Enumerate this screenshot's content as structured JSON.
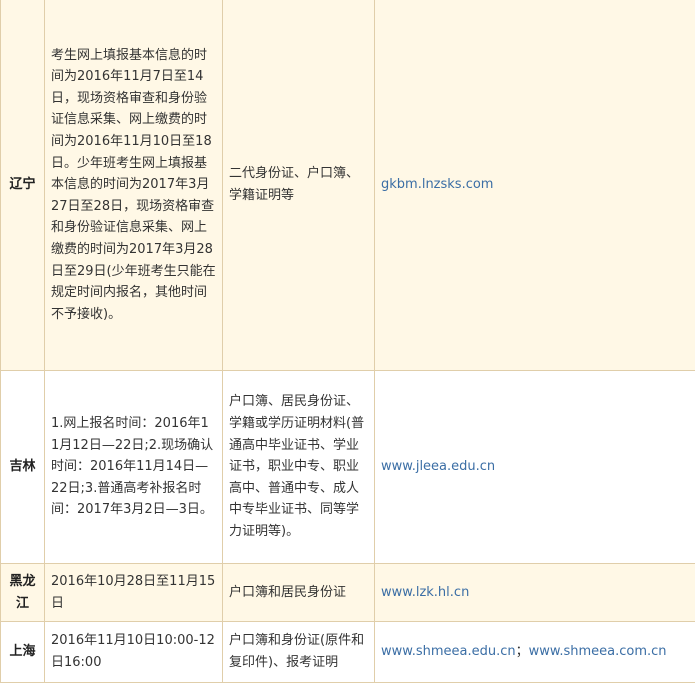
{
  "rows": [
    {
      "province": "辽宁",
      "time": "考生网上填报基本信息的时间为2016年11月7日至14日，现场资格审查和身份验证信息采集、网上缴费的时间为2016年11月10日至18日。少年班考生网上填报基本信息的时间为2017年3月27日至28日，现场资格审查和身份验证信息采集、网上缴费的时间为2017年3月28日至29日(少年班考生只能在规定时间内报名，其他时间不予接收)。",
      "docs": "二代身份证、户口簿、学籍证明等",
      "sites": [
        "gkbm.lnzsks.com"
      ]
    },
    {
      "province": "吉林",
      "time": "1.网上报名时间：2016年11月12日—22日;2.现场确认时间：2016年11月14日—22日;3.普通高考补报名时间：2017年3月2日—3日。",
      "docs": "户口簿、居民身份证、学籍或学历证明材料(普通高中毕业证书、学业证书，职业中专、职业高中、普通中专、成人中专毕业证书、同等学力证明等)。",
      "sites": [
        "www.jleea.edu.cn"
      ]
    },
    {
      "province": "黑龙江",
      "time": "2016年10月28日至11月15日",
      "docs": "户口簿和居民身份证",
      "sites": [
        "www.lzk.hl.cn"
      ]
    },
    {
      "province": "上海",
      "time": "2016年11月10日10:00-12日16:00",
      "docs": "户口簿和身份证(原件和复印件)、报考证明",
      "sites": [
        "www.shmeea.edu.cn",
        "www.shmeea.com.cn"
      ],
      "site_separator": "；"
    }
  ]
}
